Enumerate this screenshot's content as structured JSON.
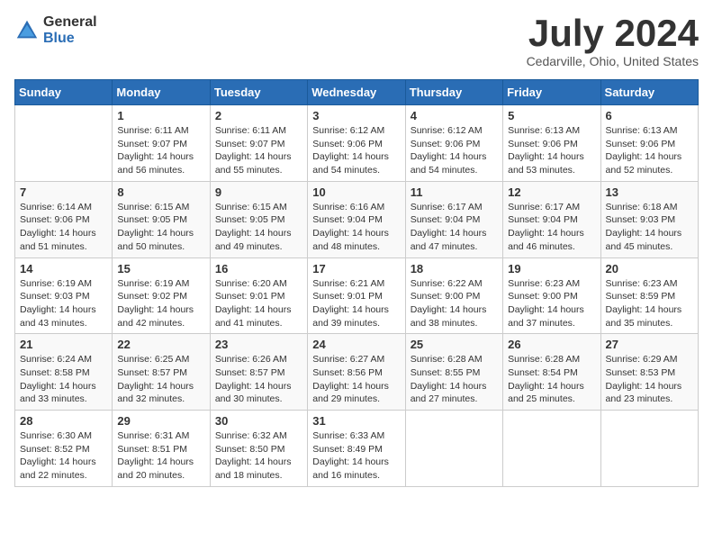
{
  "logo": {
    "general": "General",
    "blue": "Blue"
  },
  "title": "July 2024",
  "location": "Cedarville, Ohio, United States",
  "days_of_week": [
    "Sunday",
    "Monday",
    "Tuesday",
    "Wednesday",
    "Thursday",
    "Friday",
    "Saturday"
  ],
  "weeks": [
    [
      {
        "day": "",
        "info": ""
      },
      {
        "day": "1",
        "info": "Sunrise: 6:11 AM\nSunset: 9:07 PM\nDaylight: 14 hours\nand 56 minutes."
      },
      {
        "day": "2",
        "info": "Sunrise: 6:11 AM\nSunset: 9:07 PM\nDaylight: 14 hours\nand 55 minutes."
      },
      {
        "day": "3",
        "info": "Sunrise: 6:12 AM\nSunset: 9:06 PM\nDaylight: 14 hours\nand 54 minutes."
      },
      {
        "day": "4",
        "info": "Sunrise: 6:12 AM\nSunset: 9:06 PM\nDaylight: 14 hours\nand 54 minutes."
      },
      {
        "day": "5",
        "info": "Sunrise: 6:13 AM\nSunset: 9:06 PM\nDaylight: 14 hours\nand 53 minutes."
      },
      {
        "day": "6",
        "info": "Sunrise: 6:13 AM\nSunset: 9:06 PM\nDaylight: 14 hours\nand 52 minutes."
      }
    ],
    [
      {
        "day": "7",
        "info": "Sunrise: 6:14 AM\nSunset: 9:06 PM\nDaylight: 14 hours\nand 51 minutes."
      },
      {
        "day": "8",
        "info": "Sunrise: 6:15 AM\nSunset: 9:05 PM\nDaylight: 14 hours\nand 50 minutes."
      },
      {
        "day": "9",
        "info": "Sunrise: 6:15 AM\nSunset: 9:05 PM\nDaylight: 14 hours\nand 49 minutes."
      },
      {
        "day": "10",
        "info": "Sunrise: 6:16 AM\nSunset: 9:04 PM\nDaylight: 14 hours\nand 48 minutes."
      },
      {
        "day": "11",
        "info": "Sunrise: 6:17 AM\nSunset: 9:04 PM\nDaylight: 14 hours\nand 47 minutes."
      },
      {
        "day": "12",
        "info": "Sunrise: 6:17 AM\nSunset: 9:04 PM\nDaylight: 14 hours\nand 46 minutes."
      },
      {
        "day": "13",
        "info": "Sunrise: 6:18 AM\nSunset: 9:03 PM\nDaylight: 14 hours\nand 45 minutes."
      }
    ],
    [
      {
        "day": "14",
        "info": "Sunrise: 6:19 AM\nSunset: 9:03 PM\nDaylight: 14 hours\nand 43 minutes."
      },
      {
        "day": "15",
        "info": "Sunrise: 6:19 AM\nSunset: 9:02 PM\nDaylight: 14 hours\nand 42 minutes."
      },
      {
        "day": "16",
        "info": "Sunrise: 6:20 AM\nSunset: 9:01 PM\nDaylight: 14 hours\nand 41 minutes."
      },
      {
        "day": "17",
        "info": "Sunrise: 6:21 AM\nSunset: 9:01 PM\nDaylight: 14 hours\nand 39 minutes."
      },
      {
        "day": "18",
        "info": "Sunrise: 6:22 AM\nSunset: 9:00 PM\nDaylight: 14 hours\nand 38 minutes."
      },
      {
        "day": "19",
        "info": "Sunrise: 6:23 AM\nSunset: 9:00 PM\nDaylight: 14 hours\nand 37 minutes."
      },
      {
        "day": "20",
        "info": "Sunrise: 6:23 AM\nSunset: 8:59 PM\nDaylight: 14 hours\nand 35 minutes."
      }
    ],
    [
      {
        "day": "21",
        "info": "Sunrise: 6:24 AM\nSunset: 8:58 PM\nDaylight: 14 hours\nand 33 minutes."
      },
      {
        "day": "22",
        "info": "Sunrise: 6:25 AM\nSunset: 8:57 PM\nDaylight: 14 hours\nand 32 minutes."
      },
      {
        "day": "23",
        "info": "Sunrise: 6:26 AM\nSunset: 8:57 PM\nDaylight: 14 hours\nand 30 minutes."
      },
      {
        "day": "24",
        "info": "Sunrise: 6:27 AM\nSunset: 8:56 PM\nDaylight: 14 hours\nand 29 minutes."
      },
      {
        "day": "25",
        "info": "Sunrise: 6:28 AM\nSunset: 8:55 PM\nDaylight: 14 hours\nand 27 minutes."
      },
      {
        "day": "26",
        "info": "Sunrise: 6:28 AM\nSunset: 8:54 PM\nDaylight: 14 hours\nand 25 minutes."
      },
      {
        "day": "27",
        "info": "Sunrise: 6:29 AM\nSunset: 8:53 PM\nDaylight: 14 hours\nand 23 minutes."
      }
    ],
    [
      {
        "day": "28",
        "info": "Sunrise: 6:30 AM\nSunset: 8:52 PM\nDaylight: 14 hours\nand 22 minutes."
      },
      {
        "day": "29",
        "info": "Sunrise: 6:31 AM\nSunset: 8:51 PM\nDaylight: 14 hours\nand 20 minutes."
      },
      {
        "day": "30",
        "info": "Sunrise: 6:32 AM\nSunset: 8:50 PM\nDaylight: 14 hours\nand 18 minutes."
      },
      {
        "day": "31",
        "info": "Sunrise: 6:33 AM\nSunset: 8:49 PM\nDaylight: 14 hours\nand 16 minutes."
      },
      {
        "day": "",
        "info": ""
      },
      {
        "day": "",
        "info": ""
      },
      {
        "day": "",
        "info": ""
      }
    ]
  ]
}
